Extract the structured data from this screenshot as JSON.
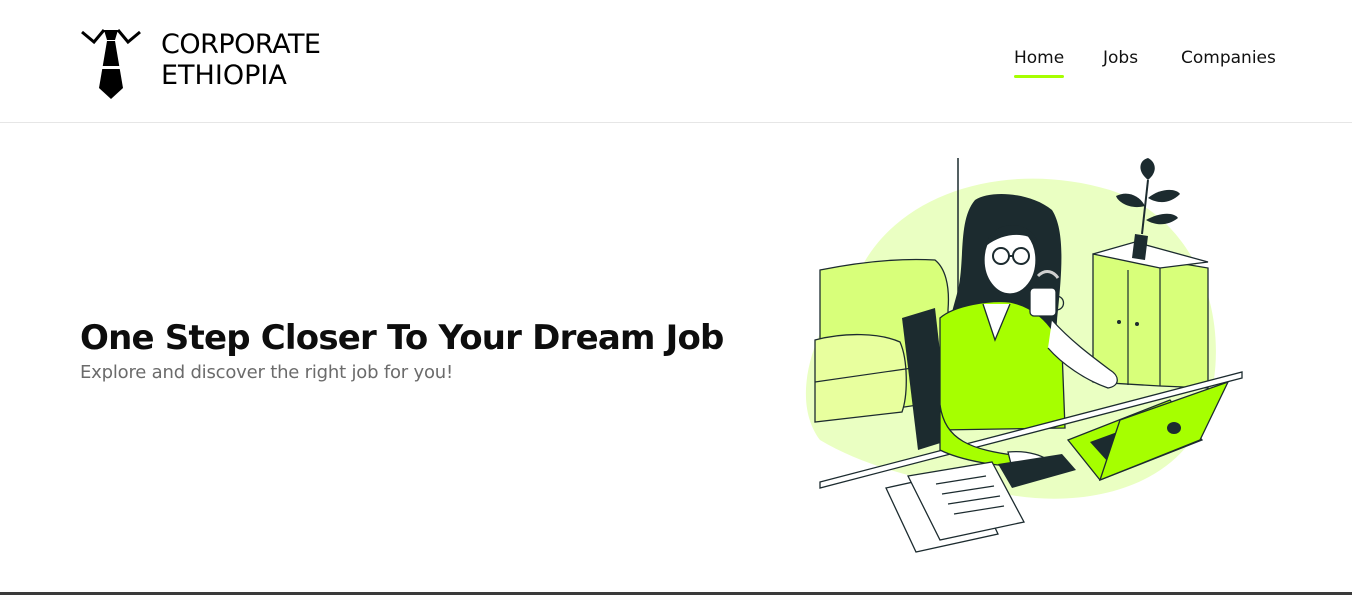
{
  "brand": {
    "name_line1": "CORPORATE",
    "name_line2": "ETHIOPIA",
    "icon": "tie-icon"
  },
  "nav": {
    "items": [
      {
        "label": "Home",
        "active": true
      },
      {
        "label": "Jobs",
        "active": false
      },
      {
        "label": "Companies",
        "active": false
      }
    ]
  },
  "hero": {
    "title": "One Step Closer To Your Dream Job",
    "subtitle": "Explore and discover the right job for you!",
    "illustration": "woman-working-laptop-illustration"
  },
  "colors": {
    "accent": "#a6ff00",
    "accent_light": "#eaffc2",
    "ink": "#1c2b2f"
  }
}
